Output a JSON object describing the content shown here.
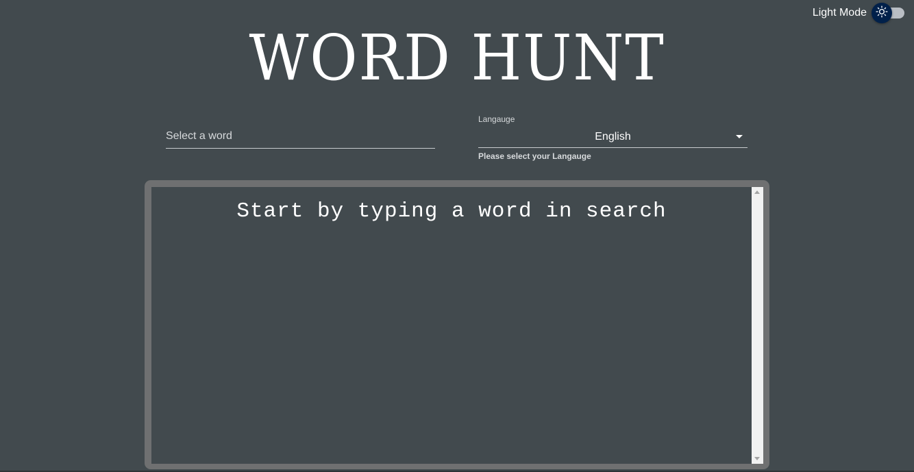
{
  "theme_toggle": {
    "label": "Light Mode",
    "icon": "sun-icon",
    "track_color": "#b9bec4",
    "thumb_color": "#00204a"
  },
  "header": {
    "title": "WORD HUNT"
  },
  "search": {
    "placeholder": "Select a word",
    "value": ""
  },
  "language": {
    "label": "Langauge",
    "selected": "English",
    "helper_text": "Please select your Langauge"
  },
  "results": {
    "message": "Start by typing a word in search"
  },
  "colors": {
    "background": "#424a4e",
    "panel_border": "#6f7071",
    "text": "#ffffff"
  }
}
